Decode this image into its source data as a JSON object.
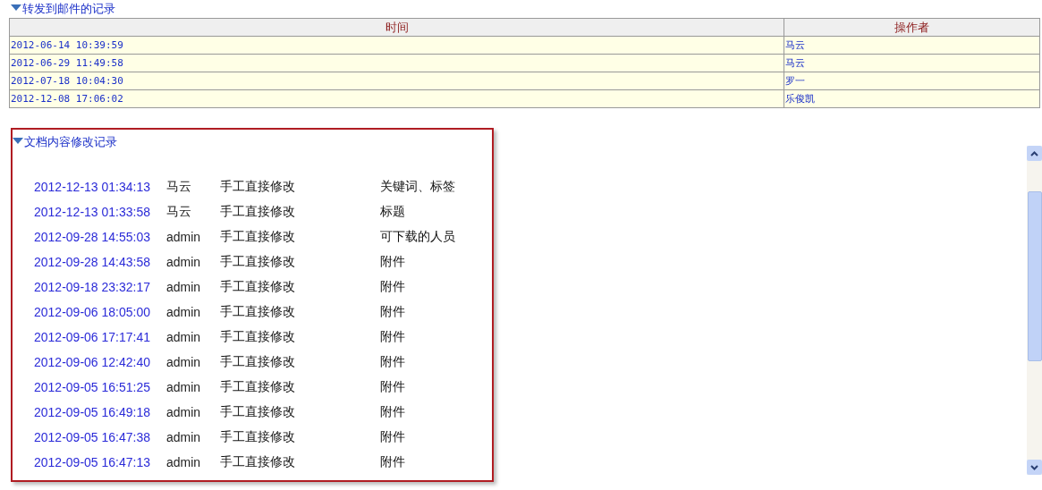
{
  "forward_log": {
    "title": "转发到邮件的记录",
    "columns": [
      "时间",
      "操作者"
    ],
    "rows": [
      {
        "time": "2012-06-14 10:39:59",
        "operator": "马云"
      },
      {
        "time": "2012-06-29 11:49:58",
        "operator": "马云"
      },
      {
        "time": "2012-07-18 10:04:30",
        "operator": "罗一"
      },
      {
        "time": "2012-12-08 17:06:02",
        "operator": "乐俊凯"
      }
    ]
  },
  "edit_log": {
    "title": "文档内容修改记录",
    "rows": [
      {
        "time": "2012-12-13 01:34:13",
        "user": "马云",
        "method": "手工直接修改",
        "field": "关键词、标签"
      },
      {
        "time": "2012-12-13 01:33:58",
        "user": "马云",
        "method": "手工直接修改",
        "field": "标题"
      },
      {
        "time": "2012-09-28 14:55:03",
        "user": "admin",
        "method": "手工直接修改",
        "field": "可下载的人员"
      },
      {
        "time": "2012-09-28 14:43:58",
        "user": "admin",
        "method": "手工直接修改",
        "field": "附件"
      },
      {
        "time": "2012-09-18 23:32:17",
        "user": "admin",
        "method": "手工直接修改",
        "field": "附件"
      },
      {
        "time": "2012-09-06 18:05:00",
        "user": "admin",
        "method": "手工直接修改",
        "field": "附件"
      },
      {
        "time": "2012-09-06 17:17:41",
        "user": "admin",
        "method": "手工直接修改",
        "field": "附件"
      },
      {
        "time": "2012-09-06 12:42:40",
        "user": "admin",
        "method": "手工直接修改",
        "field": "附件"
      },
      {
        "time": "2012-09-05 16:51:25",
        "user": "admin",
        "method": "手工直接修改",
        "field": "附件"
      },
      {
        "time": "2012-09-05 16:49:18",
        "user": "admin",
        "method": "手工直接修改",
        "field": "附件"
      },
      {
        "time": "2012-09-05 16:47:38",
        "user": "admin",
        "method": "手工直接修改",
        "field": "附件"
      },
      {
        "time": "2012-09-05 16:47:13",
        "user": "admin",
        "method": "手工直接修改",
        "field": "附件"
      }
    ]
  }
}
